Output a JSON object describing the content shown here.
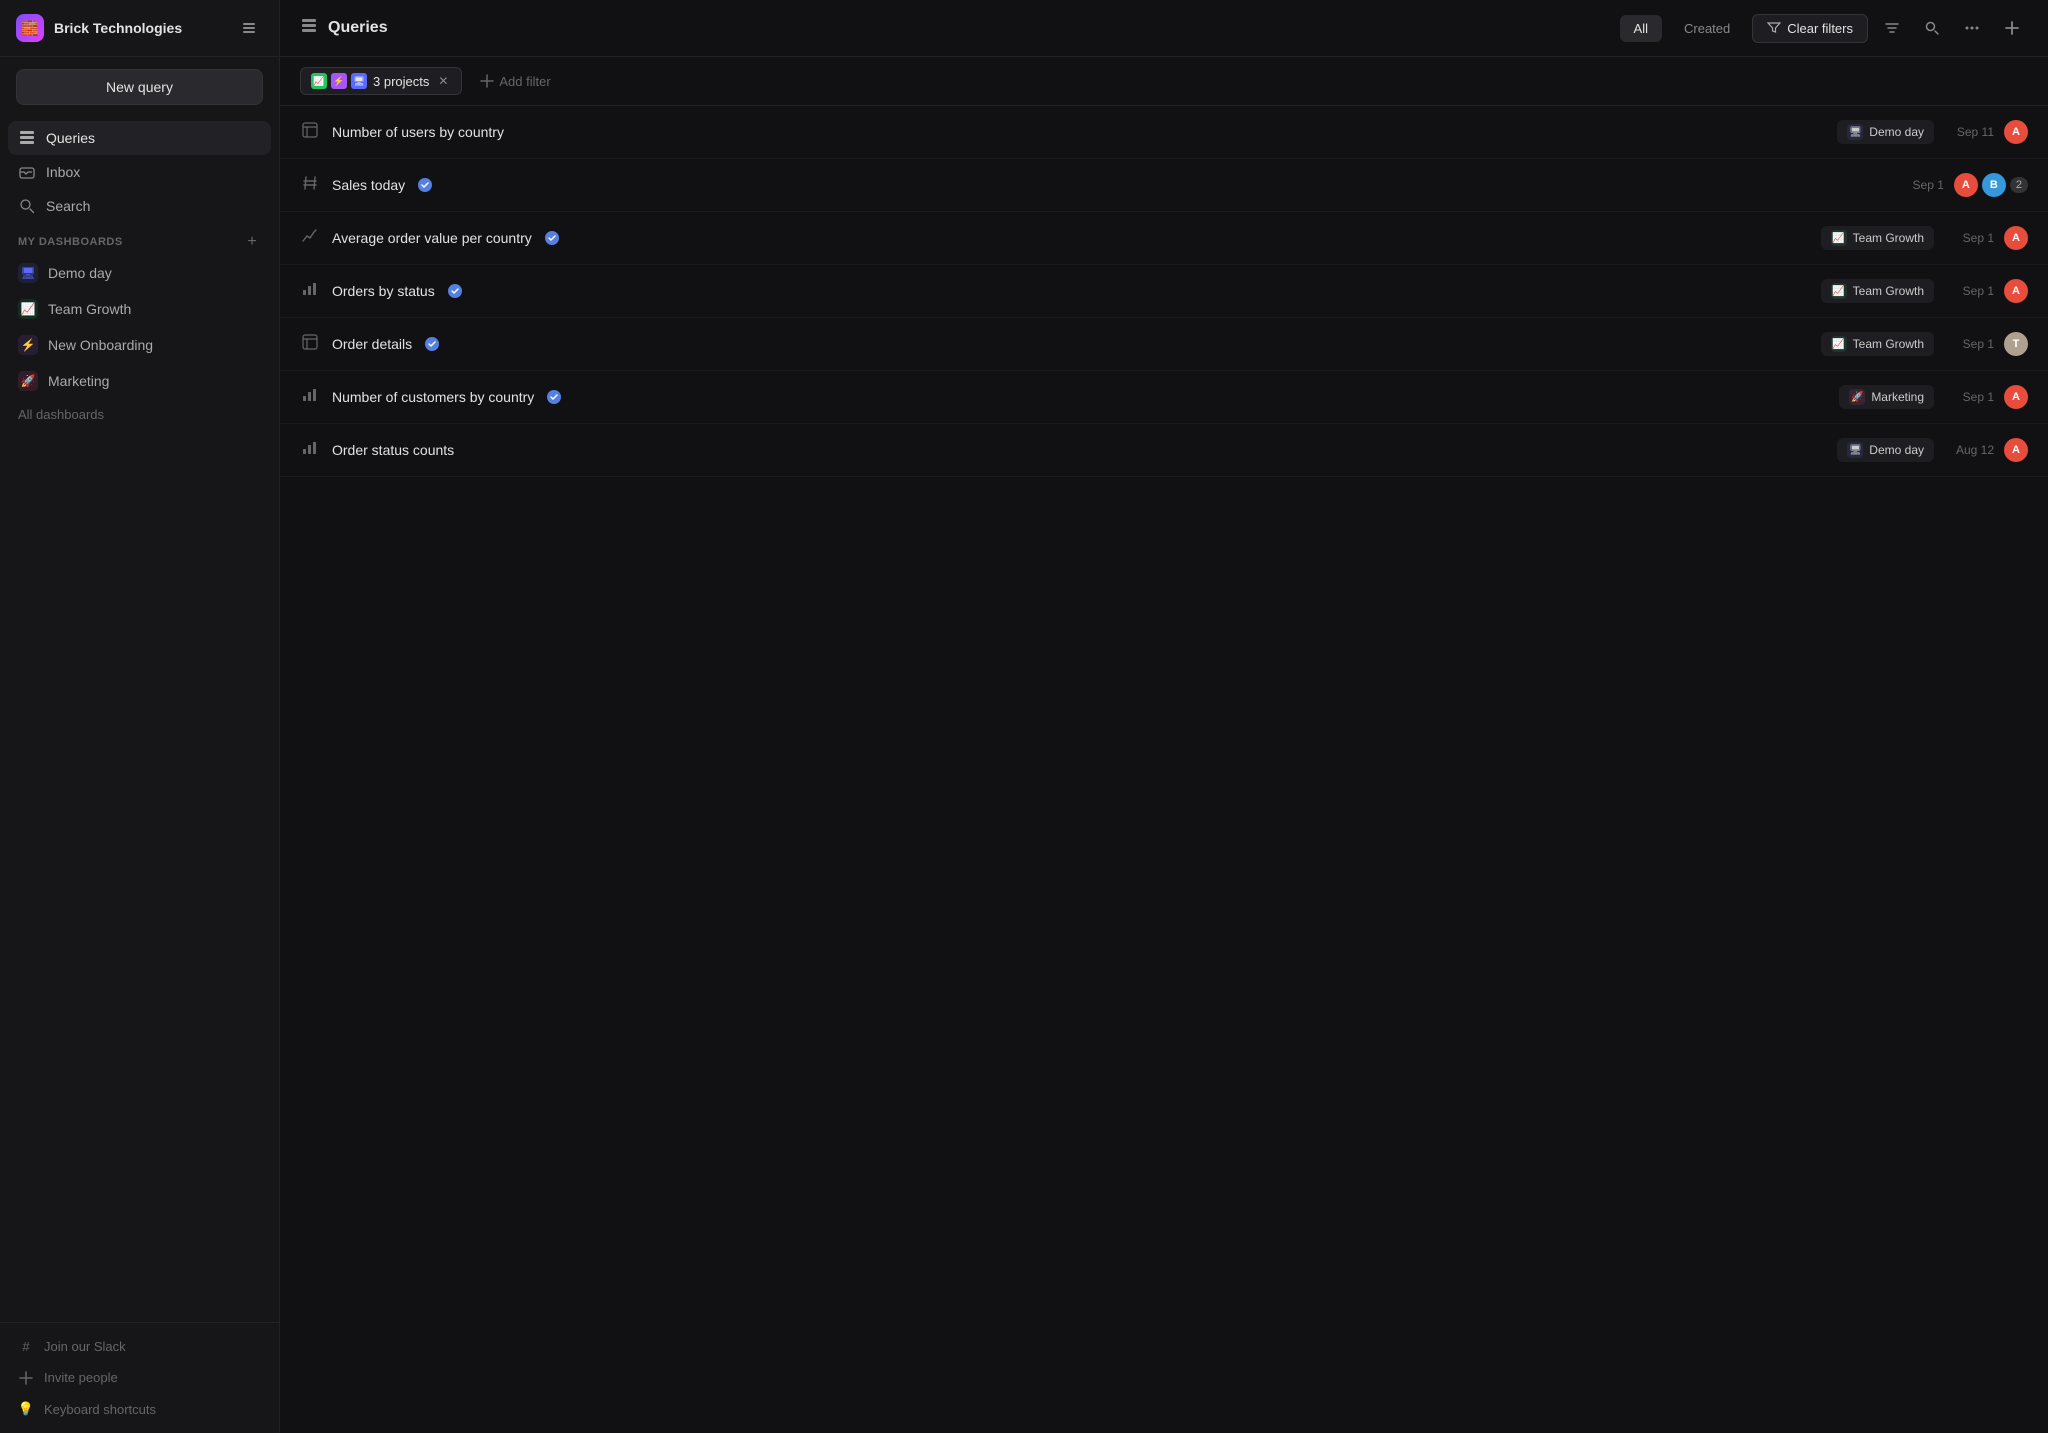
{
  "app": {
    "brand_icon": "🧱",
    "brand_name": "Brick Technologies",
    "collapse_tooltip": "Collapse sidebar"
  },
  "sidebar": {
    "new_query_label": "New query",
    "nav_items": [
      {
        "id": "queries",
        "label": "Queries",
        "icon": "☰",
        "active": true
      },
      {
        "id": "inbox",
        "label": "Inbox",
        "icon": "📥",
        "active": false
      },
      {
        "id": "search",
        "label": "Search",
        "icon": "🔍",
        "active": false
      }
    ],
    "my_dashboards_label": "My dashboards",
    "dashboards": [
      {
        "id": "demo-day",
        "label": "Demo day",
        "icon": "🖥",
        "color": "#5a6aff"
      },
      {
        "id": "team-growth",
        "label": "Team Growth",
        "icon": "📈",
        "color": "#22c55e"
      },
      {
        "id": "new-onboarding",
        "label": "New Onboarding",
        "icon": "⚡",
        "color": "#a855f7"
      },
      {
        "id": "marketing",
        "label": "Marketing",
        "icon": "🚀",
        "color": "#ec4899"
      }
    ],
    "all_dashboards_label": "All dashboards",
    "footer": [
      {
        "id": "slack",
        "label": "Join our Slack",
        "icon": "#"
      },
      {
        "id": "invite",
        "label": "Invite people",
        "icon": "+"
      },
      {
        "id": "shortcuts",
        "label": "Keyboard shortcuts",
        "icon": "💡"
      }
    ]
  },
  "topbar": {
    "page_icon": "☰",
    "title": "Queries",
    "view_all_label": "All",
    "view_created_label": "Created",
    "clear_filters_label": "Clear filters",
    "sort_icon": "sort",
    "search_icon": "search",
    "more_icon": "more",
    "add_icon": "add"
  },
  "filter_bar": {
    "chip_label": "3 projects",
    "chip_icons": [
      {
        "color": "#22c55e",
        "symbol": "📈"
      },
      {
        "color": "#a855f7",
        "symbol": "⚡"
      },
      {
        "color": "#5a6aff",
        "symbol": "🖥"
      }
    ],
    "add_filter_label": "Add filter"
  },
  "queries": [
    {
      "id": "q1",
      "name": "Number of users by country",
      "type_icon": "table",
      "verified": false,
      "dashboard_label": "Demo day",
      "dashboard_icon": "🖥",
      "dashboard_color": "#5a6aff",
      "date": "Sep 11",
      "avatar_color": "#e74c3c",
      "avatar_initials": "A",
      "multi_avatar": false
    },
    {
      "id": "q2",
      "name": "Sales today",
      "type_icon": "hash",
      "verified": true,
      "dashboard_label": null,
      "dashboard_icon": null,
      "dashboard_color": null,
      "date": "Sep 1",
      "avatar_color": "#e74c3c",
      "avatar_initials": "A",
      "multi_avatar": true,
      "extra_count": 2
    },
    {
      "id": "q3",
      "name": "Average order value per country",
      "type_icon": "trend",
      "verified": true,
      "dashboard_label": "Team Growth",
      "dashboard_icon": "📈",
      "dashboard_color": "#22c55e",
      "date": "Sep 1",
      "avatar_color": "#e74c3c",
      "avatar_initials": "A",
      "multi_avatar": false
    },
    {
      "id": "q4",
      "name": "Orders by status",
      "type_icon": "bar",
      "verified": true,
      "dashboard_label": "Team Growth",
      "dashboard_icon": "📈",
      "dashboard_color": "#22c55e",
      "date": "Sep 1",
      "avatar_color": "#e74c3c",
      "avatar_initials": "A",
      "multi_avatar": false
    },
    {
      "id": "q5",
      "name": "Order details",
      "type_icon": "table",
      "verified": true,
      "dashboard_label": "Team Growth",
      "dashboard_icon": "📈",
      "dashboard_color": "#22c55e",
      "date": "Sep 1",
      "avatar_color": "#b0a090",
      "avatar_initials": "T",
      "multi_avatar": false
    },
    {
      "id": "q6",
      "name": "Number of customers by country",
      "type_icon": "bar",
      "verified": true,
      "dashboard_label": "Marketing",
      "dashboard_icon": "🚀",
      "dashboard_color": "#ec4899",
      "date": "Sep 1",
      "avatar_color": "#e74c3c",
      "avatar_initials": "A",
      "multi_avatar": false
    },
    {
      "id": "q7",
      "name": "Order status counts",
      "type_icon": "bar",
      "verified": false,
      "dashboard_label": "Demo day",
      "dashboard_icon": "🖥",
      "dashboard_color": "#5a6aff",
      "date": "Aug 12",
      "avatar_color": "#e74c3c",
      "avatar_initials": "A",
      "multi_avatar": false
    }
  ],
  "icons": {
    "table": "⊞",
    "hash": "#",
    "trend": "📈",
    "bar": "📊"
  }
}
